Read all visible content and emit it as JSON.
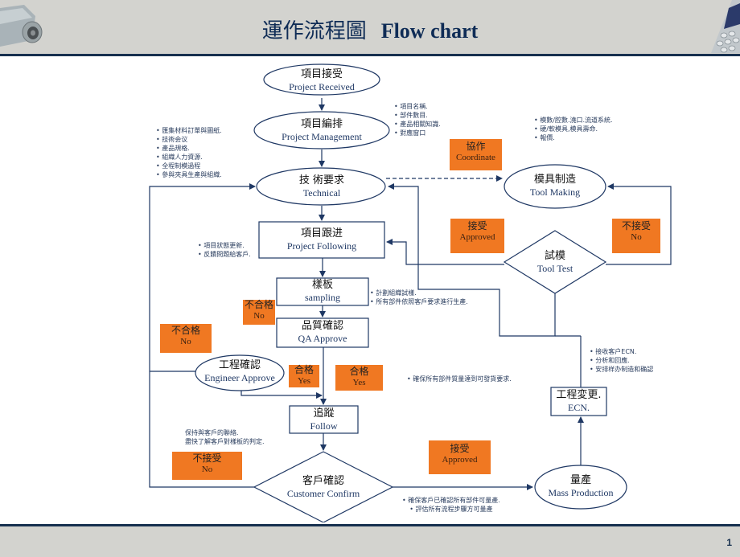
{
  "header": {
    "title_cn": "運作流程圖",
    "title_en": "Flow chart"
  },
  "footer": {
    "page_number": "1"
  },
  "colors": {
    "accent": "#f07822",
    "line": "#1f3864",
    "header_bg": "#d3d3cf",
    "border": "#17304f"
  },
  "nodes": {
    "project_received": {
      "cn": "項目接受",
      "en": "Project Received"
    },
    "project_management": {
      "cn": "項目編排",
      "en": "Project Management"
    },
    "technical": {
      "cn": "技 術要求",
      "en": "Technical"
    },
    "tool_making": {
      "cn": "模具制造",
      "en": "Tool Making"
    },
    "project_following": {
      "cn": "項目跟进",
      "en": "Project Following"
    },
    "tool_test": {
      "cn": "試模",
      "en": "Tool Test"
    },
    "sampling": {
      "cn": "樣板",
      "en": "sampling"
    },
    "qa_approve": {
      "cn": "品質確認",
      "en": "QA Approve"
    },
    "engineer_approve": {
      "cn": "工程確認",
      "en": "Engineer Approve"
    },
    "follow": {
      "cn": "追蹤",
      "en": "Follow"
    },
    "customer_confirm": {
      "cn": "客戶確認",
      "en": "Customer Confirm"
    },
    "mass_production": {
      "cn": "量產",
      "en": "Mass Production"
    },
    "ecn": {
      "cn": "工程変更.",
      "en": "ECN."
    }
  },
  "badges": {
    "coordinate": {
      "cn": "協作",
      "en": "Coordinate"
    },
    "approved_tool": {
      "cn": "接受",
      "en": "Approved"
    },
    "no_tool": {
      "cn": "不接受",
      "en": "No"
    },
    "no_sampling": {
      "cn": "不合格",
      "en": "No"
    },
    "no_qa": {
      "cn": "不合格",
      "en": "No"
    },
    "yes_engineer": {
      "cn": "合格",
      "en": "Yes"
    },
    "yes_qa": {
      "cn": "合格",
      "en": "Yes"
    },
    "no_customer": {
      "cn": "不接受",
      "en": "No"
    },
    "approved_customer": {
      "cn": "接受",
      "en": "Approved"
    }
  },
  "notes": {
    "management_right": [
      "項目名稱.",
      "部件數目.",
      "產品相關知識.",
      "對應窗口"
    ],
    "management_left": [
      "匯集材料訂單與圖紙.",
      "技術会议",
      "產品規格.",
      "組織人力資源.",
      "全程制模過程",
      "參與夾具生產與組織."
    ],
    "tool_making": [
      "模數/腔數.澆口.流道系統.",
      "硬/軟模具,模具壽命.",
      "報價."
    ],
    "following": [
      "項目狀態更新.",
      "反饋問題給客戶."
    ],
    "sampling": [
      "計劃組織試樣.",
      "所有部件依照客戶要求進行生產."
    ],
    "qa": [
      "確保所有部件質量達到可發貨要求."
    ],
    "ecn": [
      "接收客户ECN.",
      "分析和回應.",
      "安排样办制造和确認"
    ],
    "follow": [
      "保持與客戶的聯絡.",
      "盡快了解客戶對樣板的判定."
    ],
    "customer": [
      "確保客戶已確認所有部件可量產.",
      "評估所有流程步驟方可量產"
    ]
  }
}
